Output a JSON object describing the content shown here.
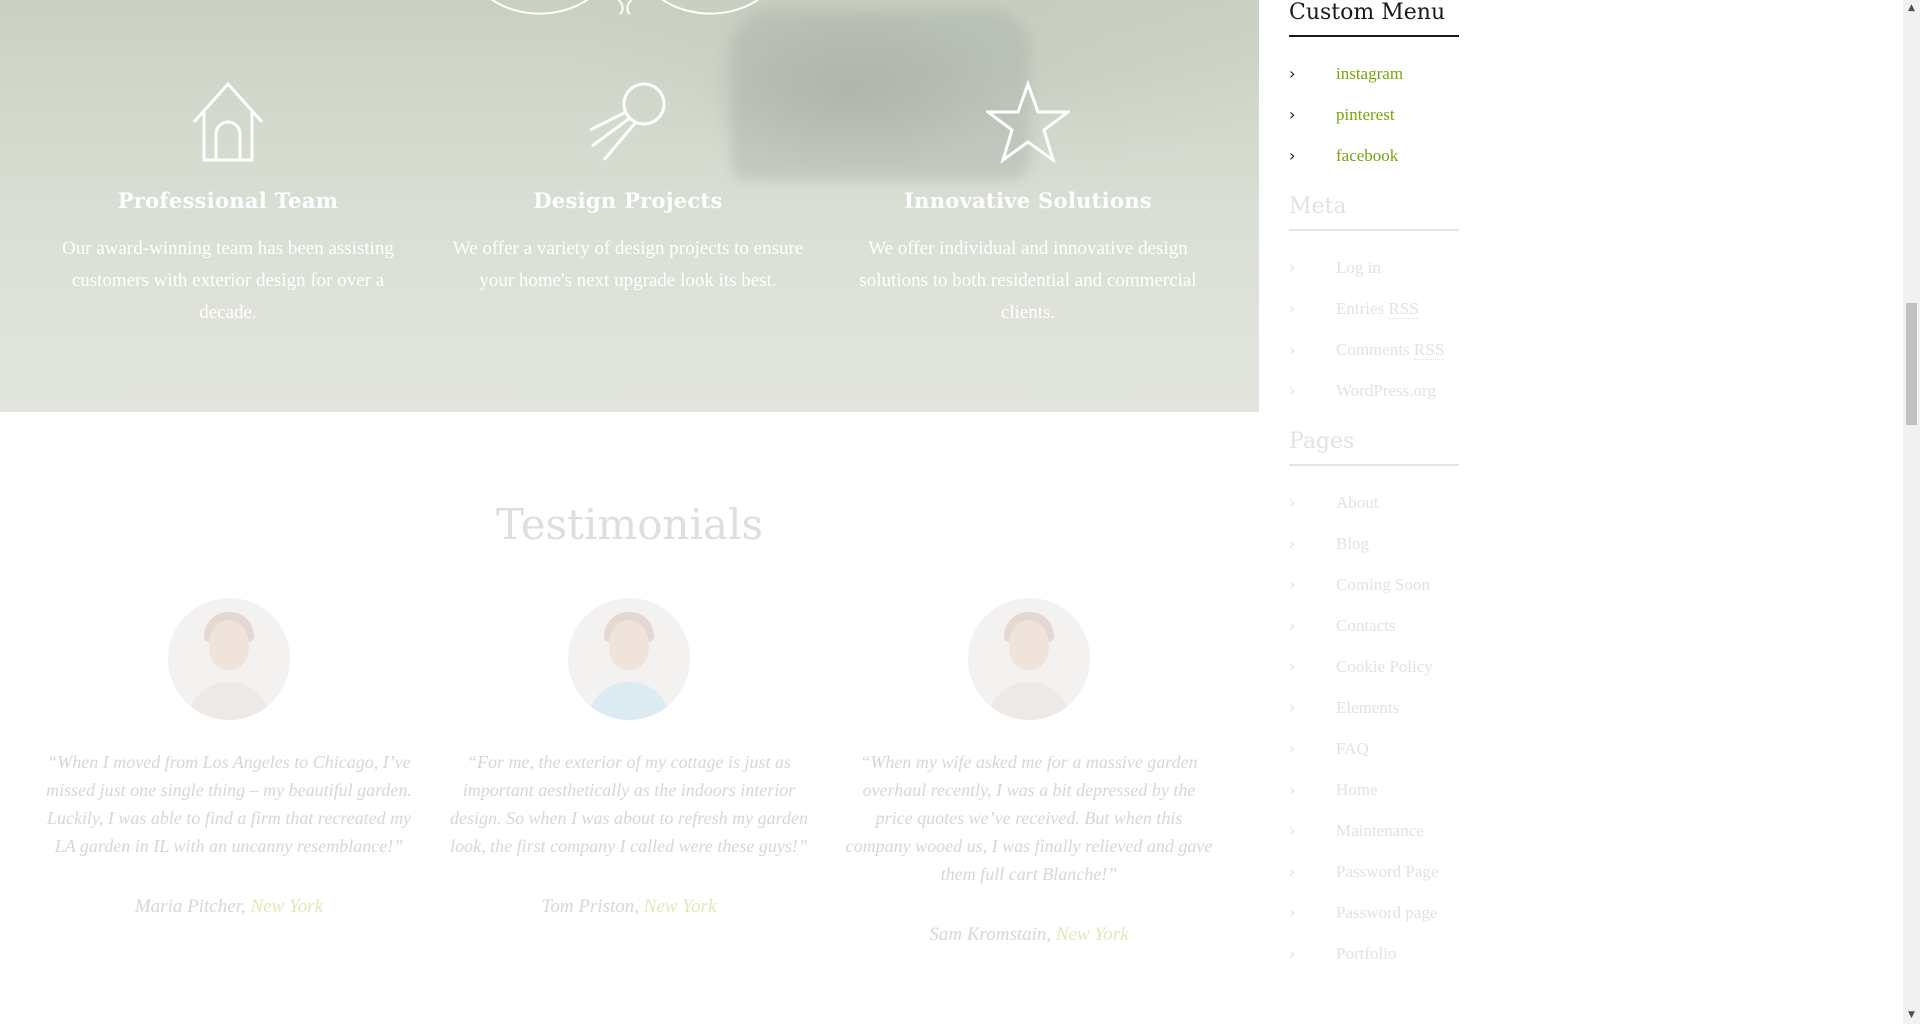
{
  "features": [
    {
      "icon": "home-icon",
      "title": "Professional Team",
      "text": "Our award-winning team has been assisting customers with exterior design for over a decade."
    },
    {
      "icon": "satellite-icon",
      "title": "Design Projects",
      "text": "We offer a variety of design projects to ensure your home's next upgrade look its best."
    },
    {
      "icon": "star-icon",
      "title": "Innovative Solutions",
      "text": "We offer individual and innovative design solutions to both residential and commercial clients."
    }
  ],
  "testimonials": {
    "title": "Testimonials",
    "items": [
      {
        "quote": "“When I moved from Los Angeles to Chicago, I’ve missed just one single thing – my beautiful garden. Luckily, I was able to find a firm that recreated my LA garden in IL with an uncanny resemblance!”",
        "name": "Maria Pitcher,",
        "location": "New York"
      },
      {
        "quote": "“For me, the exterior of my cottage is just as important aesthetically as the indoors interior design. So when I was about to refresh my garden look, the first company I called were these guys!”",
        "name": "Tom Priston,",
        "location": "New York"
      },
      {
        "quote": "“When my wife asked me for a massive garden overhaul recently, I was a bit depressed by the price quotes we’ve received. But when this company wooed us, I was finally relieved and gave them full cart Blanche!”",
        "name": "Sam Kromstain,",
        "location": "New York"
      }
    ]
  },
  "sidebar": {
    "custom_menu": {
      "title": "Custom Menu",
      "items": [
        "instagram",
        "pinterest",
        "facebook"
      ]
    },
    "meta": {
      "title": "Meta",
      "items": [
        {
          "pre": "Log in",
          "abbr": ""
        },
        {
          "pre": "Entries ",
          "abbr": "RSS"
        },
        {
          "pre": "Comments ",
          "abbr": "RSS"
        },
        {
          "pre": "WordPress.org",
          "abbr": ""
        }
      ]
    },
    "pages": {
      "title": "Pages",
      "items": [
        "About",
        "Blog",
        "Coming Soon",
        "Contacts",
        "Cookie Policy",
        "Elements",
        "FAQ",
        "Home",
        "Maintenance",
        "Password Page",
        "Password page",
        "Portfolio"
      ]
    }
  },
  "chevron_glyph": "›",
  "scroll_up": "▲",
  "scroll_down": "▼"
}
